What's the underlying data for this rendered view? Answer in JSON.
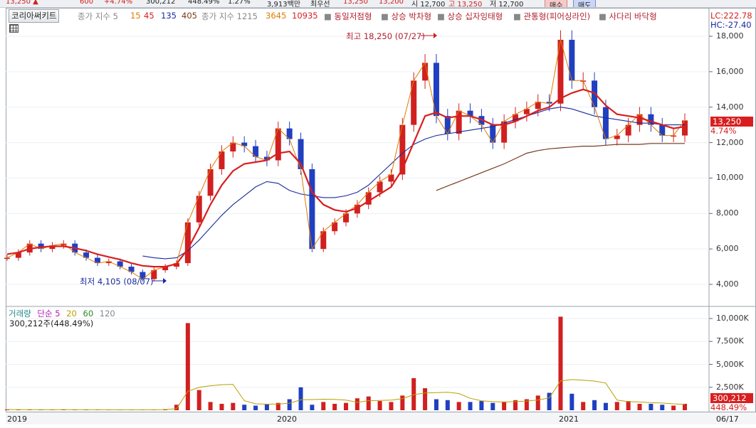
{
  "top_strip": {
    "items": [
      "13,250 ▲",
      "600",
      "+4.74%",
      "300,212",
      "448.49%",
      "1.27%",
      "3,913백만",
      "최우선",
      "13,250",
      "13,200",
      "시 12,700",
      "고 13,250",
      "저 12,700",
      "매수",
      "매도"
    ]
  },
  "legend": {
    "chart_name": "코리아써키트",
    "ma_label": "종가 지수 5",
    "ma_periods": [
      "15",
      "45",
      "135",
      "405"
    ],
    "ma2_label": "종가 지수 1215",
    "ma2_periods": [
      "3645",
      "10935"
    ],
    "patterns": [
      "동일저점형",
      "상승 박차형",
      "상승 십자잉태형",
      "관통형(피어싱라인)",
      "사다리 바닥형"
    ]
  },
  "lc": "LC:222.78",
  "hc": "HC:-27.40",
  "price_tag": "13,250",
  "pct_tag": "4.74%",
  "annotations": {
    "high": "최고 18,250 (07/27)",
    "low": "최저 4,105 (08/07)"
  },
  "volume_legend": {
    "title": "거래량",
    "label": "단순 5",
    "periods": [
      "20",
      "60",
      "120"
    ],
    "subtitle": "300,212주(448.49%)",
    "tag": "300,212",
    "tag2": "448.49%"
  },
  "dates": [
    "2019",
    "2020",
    "2021",
    "06/17"
  ],
  "colors": {
    "price_line": "#d81f1f",
    "ma_fast": "#e07b00",
    "ma_mid": "#d81f1f",
    "ma_slow": "#1a2a9c",
    "ma_long": "#7a3a1a",
    "up": "#d02020",
    "down": "#2040c0"
  },
  "chart_data": {
    "type": "line",
    "price_axis": [
      "18,000",
      "16,000",
      "14,000",
      "12,000",
      "10,000",
      "8,000",
      "6,000",
      "4,000"
    ],
    "price_ticks": [
      18000,
      16000,
      14000,
      12000,
      10000,
      8000,
      6000,
      4000
    ],
    "volume_axis": [
      "10,000K",
      "7,500K",
      "5,000K",
      "2,500K"
    ],
    "volume_ticks": [
      10000,
      7500,
      5000,
      2500
    ],
    "close": [
      5500,
      5800,
      6300,
      6000,
      6200,
      6300,
      5800,
      5500,
      5200,
      5300,
      5000,
      4700,
      4300,
      4800,
      5000,
      5200,
      7500,
      9000,
      10500,
      11500,
      12000,
      11800,
      11200,
      11000,
      12800,
      12200,
      10500,
      6000,
      7000,
      7500,
      8000,
      8500,
      9200,
      9800,
      10200,
      13000,
      15500,
      16500,
      13500,
      12500,
      13800,
      13500,
      13000,
      12000,
      13200,
      13600,
      13900,
      14300,
      14200,
      17800,
      15500,
      15500,
      14000,
      12200,
      12400,
      13000,
      13600,
      13000,
      12400,
      12400,
      13250
    ],
    "ma_mid": [
      5700,
      5800,
      6000,
      6100,
      6150,
      6150,
      6050,
      5900,
      5700,
      5550,
      5400,
      5200,
      5050,
      5000,
      5000,
      5150,
      6000,
      7200,
      8500,
      9600,
      10400,
      10800,
      10900,
      11000,
      11400,
      11500,
      10800,
      9200,
      8500,
      8200,
      8100,
      8300,
      8700,
      9100,
      9500,
      10500,
      12000,
      13500,
      13700,
      13400,
      13500,
      13500,
      13300,
      13000,
      13000,
      13200,
      13500,
      13800,
      14000,
      14500,
      14800,
      15000,
      14800,
      14100,
      13600,
      13500,
      13400,
      13200,
      13000,
      12800,
      12900
    ],
    "ma_slow_start": 12,
    "ma_slow": [
      5600,
      5500,
      5450,
      5500,
      5900,
      6500,
      7200,
      7900,
      8500,
      9000,
      9500,
      9800,
      9700,
      9300,
      9100,
      9000,
      8900,
      8900,
      9000,
      9200,
      9600,
      10200,
      10800,
      11400,
      11900,
      12200,
      12400,
      12500,
      12600,
      12700,
      12800,
      12900,
      13100,
      13300,
      13500,
      13700,
      13900,
      14000,
      13900,
      13700,
      13500,
      13400,
      13300,
      13200,
      13100,
      13100,
      13000,
      13000,
      13000
    ],
    "ma_long_start": 38,
    "ma_long": [
      9300,
      9550,
      9800,
      10050,
      10300,
      10550,
      10800,
      11100,
      11400,
      11550,
      11650,
      11700,
      11750,
      11800,
      11800,
      11850,
      11900,
      11900,
      11900,
      11950,
      11950,
      11950,
      11950
    ],
    "volume": [
      80,
      60,
      70,
      50,
      60,
      90,
      40,
      50,
      30,
      40,
      60,
      50,
      40,
      60,
      120,
      600,
      9500,
      2200,
      900,
      700,
      800,
      600,
      500,
      700,
      800,
      1200,
      2500,
      600,
      900,
      700,
      800,
      1300,
      1500,
      1000,
      900,
      1600,
      3500,
      2400,
      1200,
      1100,
      900,
      900,
      1000,
      800,
      900,
      1100,
      1200,
      1600,
      1900,
      10200,
      1800,
      900,
      1100,
      800,
      900,
      1000,
      700,
      700,
      600,
      500,
      700
    ]
  }
}
